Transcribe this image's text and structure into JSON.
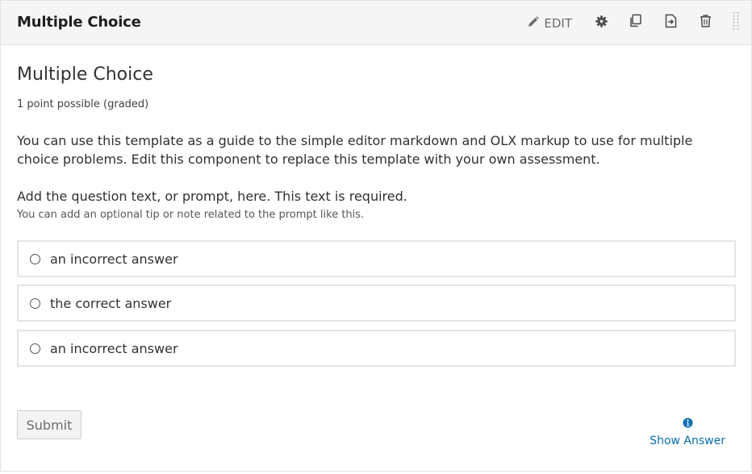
{
  "header": {
    "title": "Multiple Choice",
    "edit_label": "EDIT",
    "icons": [
      "pencil-icon",
      "gear-icon",
      "duplicate-icon",
      "move-icon",
      "trash-icon",
      "drag-handle-icon"
    ]
  },
  "problem": {
    "title": "Multiple Choice",
    "points": "1 point possible (graded)",
    "description": "You can use this template as a guide to the simple editor markdown and OLX markup to use for multiple choice problems. Edit this component to replace this template with your own assessment.",
    "prompt": "Add the question text, or prompt, here. This text is required.",
    "tip": "You can add an optional tip or note related to the prompt like this.",
    "choices": [
      {
        "label": "an incorrect answer"
      },
      {
        "label": "the correct answer"
      },
      {
        "label": "an incorrect answer"
      }
    ]
  },
  "footer": {
    "submit_label": "Submit",
    "show_answer_label": "Show Answer"
  },
  "colors": {
    "link": "#0a6fb0",
    "header_bg": "#f5f5f5",
    "border": "#e5e5e5"
  }
}
